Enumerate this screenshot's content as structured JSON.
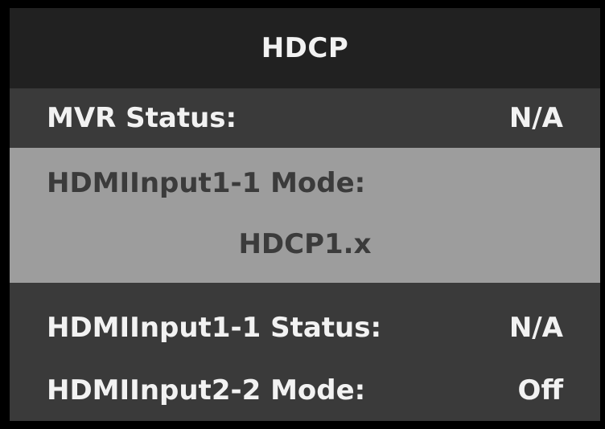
{
  "header": {
    "title": "HDCP"
  },
  "menu": {
    "mvr_status": {
      "label": "MVR Status:",
      "value": "N/A"
    },
    "hdmi_input_1_1_mode": {
      "label": "HDMIInput1-1 Mode:",
      "value": "HDCP1.x",
      "selected": true
    },
    "hdmi_input_1_1_status": {
      "label": "HDMIInput1-1 Status:",
      "value": "N/A"
    },
    "hdmi_input_2_2_mode": {
      "label": "HDMIInput2-2 Mode:",
      "value": "Off"
    }
  },
  "colors": {
    "title_bar": "#212121",
    "background": "#3a3a3a",
    "selected_background": "#9d9d9d",
    "text": "#f2f2f2",
    "selected_text": "#3b3b3b"
  }
}
